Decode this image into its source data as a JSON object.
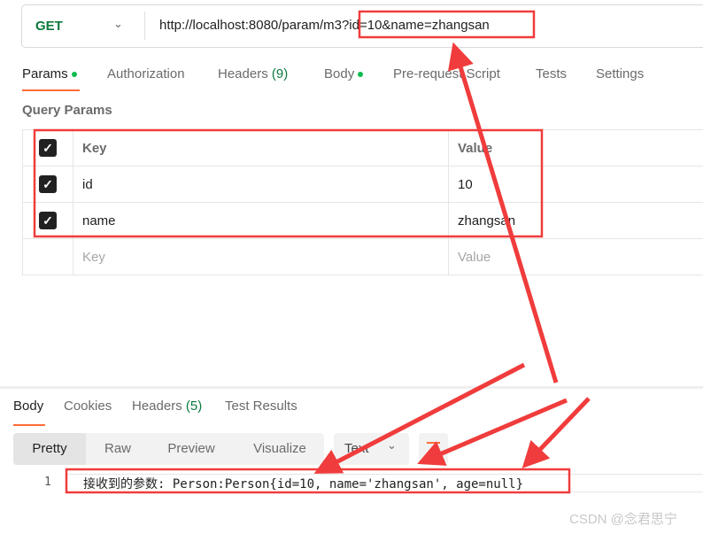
{
  "request": {
    "method": "GET",
    "url": "http://localhost:8080/param/m3?id=10&name=zhangsan"
  },
  "tabs": [
    {
      "label": "Params",
      "dot": true
    },
    {
      "label": "Authorization"
    },
    {
      "label": "Headers",
      "count": "(9)"
    },
    {
      "label": "Body",
      "dot": true
    },
    {
      "label": "Pre-request Script"
    },
    {
      "label": "Tests"
    },
    {
      "label": "Settings"
    }
  ],
  "query_params": {
    "title": "Query Params",
    "headers": [
      "Key",
      "Value"
    ],
    "rows": [
      {
        "checked": true,
        "key": "id",
        "value": "10"
      },
      {
        "checked": true,
        "key": "name",
        "value": "zhangsan"
      }
    ],
    "placeholder": {
      "key": "Key",
      "value": "Value"
    }
  },
  "response": {
    "tabs": [
      {
        "label": "Body"
      },
      {
        "label": "Cookies"
      },
      {
        "label": "Headers",
        "count": "(5)"
      },
      {
        "label": "Test Results"
      }
    ],
    "views": [
      "Pretty",
      "Raw",
      "Preview",
      "Visualize"
    ],
    "format": "Text",
    "lines": [
      {
        "num": "1",
        "text": "接收到的参数: Person:Person{id=10, name='zhangsan', age=null}"
      }
    ]
  },
  "watermark": "CSDN @念君思宁",
  "colors": {
    "accent": "#ff6c37",
    "annotation": "#f03c3c",
    "method": "#0b7a3e"
  }
}
